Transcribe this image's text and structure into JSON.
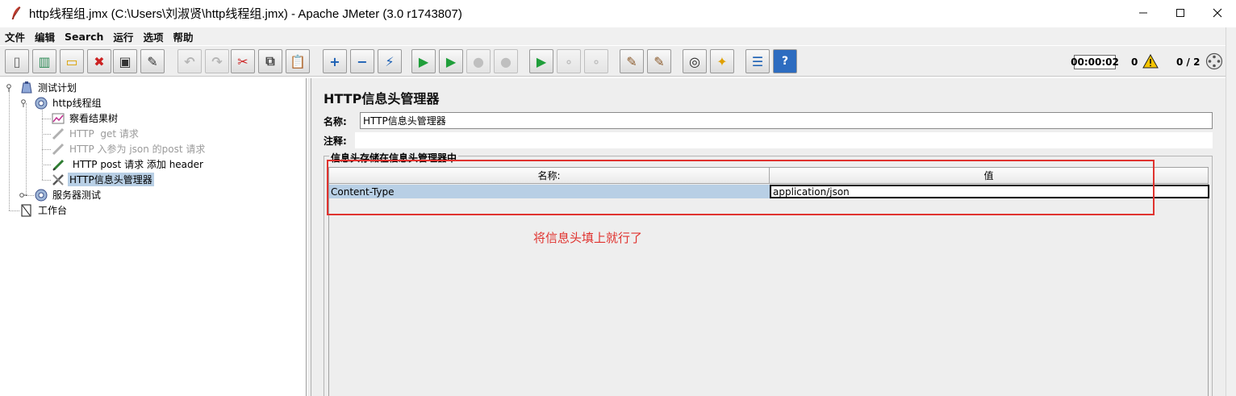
{
  "window": {
    "title": "http线程组.jmx (C:\\Users\\刘淑贤\\http线程组.jmx) - Apache JMeter (3.0 r1743807)",
    "minimize": "—",
    "maximize": "☐",
    "close": "✕"
  },
  "menu": [
    "文件",
    "编辑",
    "Search",
    "运行",
    "选项",
    "帮助"
  ],
  "toolbar": {
    "buttons": [
      {
        "name": "new-icon",
        "glyph": "▯",
        "color": "#666666",
        "disabled": false
      },
      {
        "name": "templates-icon",
        "glyph": "▥",
        "color": "#2e8b57",
        "disabled": false
      },
      {
        "name": "open-icon",
        "glyph": "▭",
        "color": "#d9a000",
        "disabled": false
      },
      {
        "name": "close-icon",
        "glyph": "✖",
        "color": "#cc2222",
        "disabled": false
      },
      {
        "name": "save-icon",
        "glyph": "▣",
        "color": "#333333",
        "disabled": false
      },
      {
        "name": "save-as-icon",
        "glyph": "✎",
        "color": "#333333",
        "disabled": false
      },
      {
        "name": "undo-icon",
        "glyph": "↶",
        "color": "#888888",
        "disabled": true
      },
      {
        "name": "redo-icon",
        "glyph": "↷",
        "color": "#888888",
        "disabled": true
      },
      {
        "name": "cut-icon",
        "glyph": "✂",
        "color": "#cc2222",
        "disabled": false
      },
      {
        "name": "copy-icon",
        "glyph": "⧉",
        "color": "#444444",
        "disabled": false
      },
      {
        "name": "paste-icon",
        "glyph": "📋",
        "color": "#8b5a2b",
        "disabled": false
      },
      {
        "name": "expand-icon",
        "glyph": "+",
        "color": "#1a5fb4",
        "disabled": false
      },
      {
        "name": "collapse-icon",
        "glyph": "−",
        "color": "#1a5fb4",
        "disabled": false
      },
      {
        "name": "toggle-icon",
        "glyph": "⚡",
        "color": "#1a5fb4",
        "disabled": false
      },
      {
        "name": "start-icon",
        "glyph": "▶",
        "color": "#1f9e3a",
        "disabled": false
      },
      {
        "name": "start-no-pause-icon",
        "glyph": "▶",
        "color": "#1f9e3a",
        "disabled": false
      },
      {
        "name": "stop-icon",
        "glyph": "●",
        "color": "#999999",
        "disabled": true
      },
      {
        "name": "shutdown-icon",
        "glyph": "●",
        "color": "#999999",
        "disabled": true
      },
      {
        "name": "remote-start-icon",
        "glyph": "▶",
        "color": "#1f9e3a",
        "disabled": false
      },
      {
        "name": "remote-stop-icon",
        "glyph": "∘",
        "color": "#999999",
        "disabled": true
      },
      {
        "name": "remote-shutdown-icon",
        "glyph": "∘",
        "color": "#999999",
        "disabled": true
      },
      {
        "name": "clear-icon",
        "glyph": "✎",
        "color": "#8b5a2b",
        "disabled": false
      },
      {
        "name": "clear-all-icon",
        "glyph": "✎",
        "color": "#8b5a2b",
        "disabled": false
      },
      {
        "name": "search-icon",
        "glyph": "◎",
        "color": "#222222",
        "disabled": false
      },
      {
        "name": "reset-search-icon",
        "glyph": "✦",
        "color": "#e0a000",
        "disabled": false
      },
      {
        "name": "function-helper-icon",
        "glyph": "☰",
        "color": "#1a5fb4",
        "disabled": false
      },
      {
        "name": "help-icon",
        "glyph": "?",
        "color": "#ffffff",
        "disabled": false
      }
    ],
    "timer": "00:00:02",
    "warnings_count": "0",
    "threads": "0 / 2"
  },
  "tree": {
    "nodes": [
      {
        "id": "test-plan",
        "label": "测试计划",
        "icon": "test-plan-icon",
        "disabled": false,
        "selected": false
      },
      {
        "id": "thread-group",
        "label": "http线程组",
        "icon": "thread-group-gear-icon",
        "disabled": false,
        "selected": false
      },
      {
        "id": "view-results-tree",
        "label": "察看结果树",
        "icon": "listener-chart-icon",
        "disabled": false,
        "selected": false
      },
      {
        "id": "http-get",
        "label": "HTTP  get 请求",
        "icon": "sampler-pen-icon",
        "disabled": true,
        "selected": false
      },
      {
        "id": "http-json-post",
        "label": "HTTP 入参为 json 的post 请求",
        "icon": "sampler-pen-icon",
        "disabled": true,
        "selected": false
      },
      {
        "id": "http-post-header",
        "label": " HTTP post 请求 添加 header",
        "icon": "sampler-pen-icon",
        "disabled": false,
        "selected": false
      },
      {
        "id": "header-manager",
        "label": "HTTP信息头管理器",
        "icon": "config-wrench-icon",
        "disabled": false,
        "selected": true
      },
      {
        "id": "server-test",
        "label": "服务器测试",
        "icon": "thread-group-gear-icon",
        "disabled": false,
        "selected": false
      },
      {
        "id": "workbench",
        "label": "工作台",
        "icon": "workbench-icon",
        "disabled": false,
        "selected": false
      }
    ]
  },
  "panel": {
    "title": "HTTP信息头管理器",
    "name_label": "名称:",
    "name_value": "HTTP信息头管理器",
    "comment_label": "注释:",
    "comment_value": "",
    "group_title": "信息头存储在信息头管理器中",
    "table": {
      "columns": [
        "名称:",
        "值"
      ],
      "rows": [
        {
          "name": "Content-Type",
          "value": "application/json"
        }
      ]
    },
    "annotation": "将信息头填上就行了"
  },
  "colors": {
    "selection": "#b8cfe5",
    "annotation_red": "#e0332f",
    "disabled_text": "#9a9a9a"
  }
}
